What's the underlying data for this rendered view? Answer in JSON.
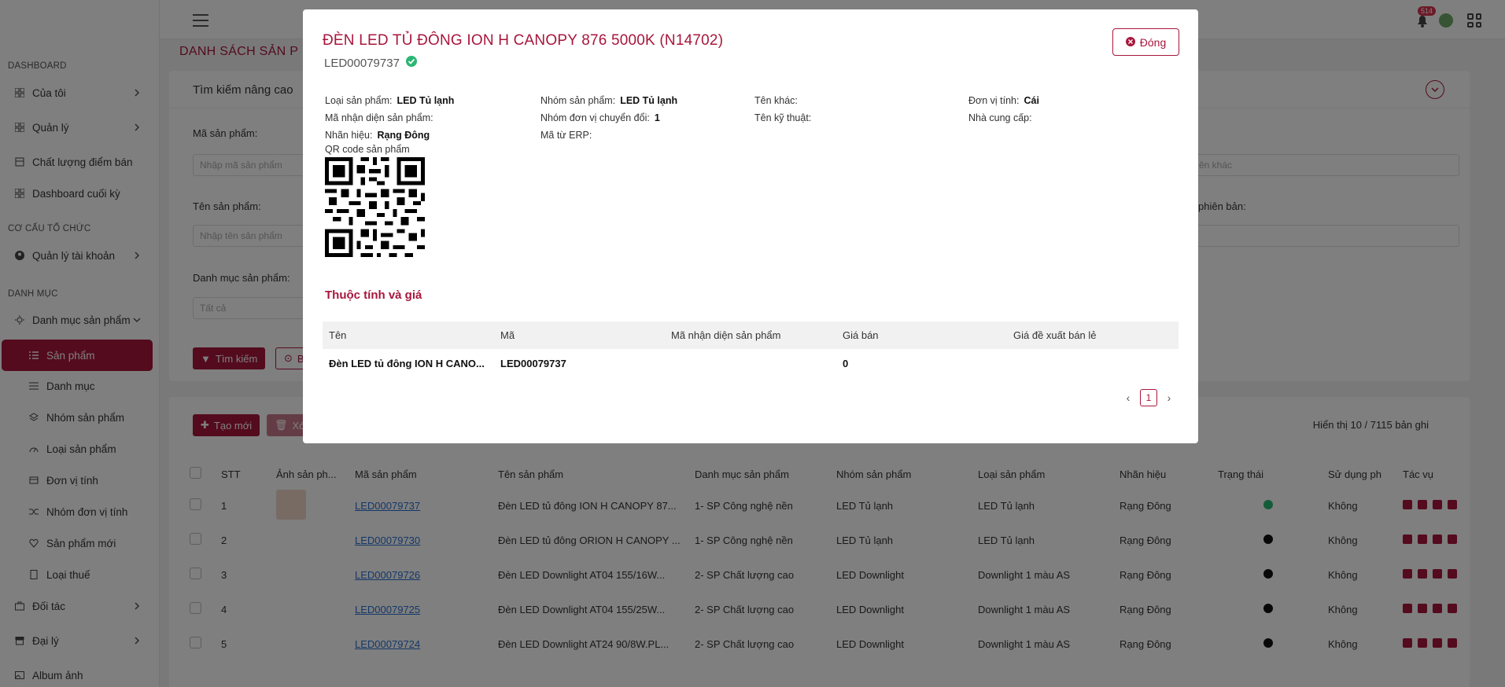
{
  "sidebar": {
    "sections": [
      "DASHBOARD",
      "CƠ CẤU TỔ CHỨC",
      "DANH MỤC"
    ],
    "items": [
      {
        "label": "Của tôi"
      },
      {
        "label": "Quản lý"
      },
      {
        "label": "Chất lượng điểm bán"
      },
      {
        "label": "Dashboard cuối kỳ"
      },
      {
        "label": "Quản lý tài khoản"
      },
      {
        "label": "Danh mục sản phẩm"
      },
      {
        "label": "Sản phẩm"
      },
      {
        "label": "Danh mục"
      },
      {
        "label": "Nhóm sản phẩm"
      },
      {
        "label": "Loại sản phẩm"
      },
      {
        "label": "Đơn vị tính"
      },
      {
        "label": "Nhóm đơn vị tính"
      },
      {
        "label": "Sản phẩm mới"
      },
      {
        "label": "Loại thuế"
      },
      {
        "label": "Đối tác"
      },
      {
        "label": "Đại lý"
      },
      {
        "label": "Album ảnh"
      }
    ]
  },
  "topbar": {
    "notification_count": "514"
  },
  "page": {
    "title": "DANH SÁCH SẢN P",
    "search": {
      "header": "Tìm kiếm nâng cao",
      "product_code_label": "Mã sản phẩm:",
      "product_code_placeholder": "Nhập mã sản phẩm",
      "product_name_label": "Tên sản phẩm:",
      "product_name_placeholder": "Nhập tên sản phẩm",
      "category_label": "Danh mục sản phẩm:",
      "category_placeholder": "Tất cả",
      "right_label_1": ":",
      "right_placeholder_1": "ên khác",
      "right_label_2": "phiên bản:",
      "search_button": "Tìm kiếm",
      "second_button": "B"
    },
    "list": {
      "create_button": "Tạo mới",
      "delete_button": "Xóa",
      "count_text": "Hiển thị 10 / 7115 bản ghi",
      "columns": [
        "STT",
        "Ảnh sản ph...",
        "Mã sản phẩm",
        "Tên sản phẩm",
        "Danh mục sản phẩm",
        "Nhóm sản phẩm",
        "Loại sản phẩm",
        "Nhãn hiệu",
        "Trạng thái",
        "Sử dụng ph",
        "Tác vụ"
      ],
      "rows": [
        {
          "stt": "1",
          "code": "LED00079737",
          "name": "Đèn LED tủ đông ION H CANOPY 87...",
          "category": "1- SP Công nghệ nền",
          "group": "LED Tủ lạnh",
          "type": "LED Tủ lạnh",
          "brand": "Rạng Đông",
          "usage": "Không"
        },
        {
          "stt": "2",
          "code": "LED00079730",
          "name": "Đèn LED tủ đông ORION H CANOPY ...",
          "category": "1- SP Công nghệ nền",
          "group": "LED Tủ lạnh",
          "type": "LED Tủ lạnh",
          "brand": "Rạng Đông",
          "usage": "Không"
        },
        {
          "stt": "3",
          "code": "LED00079726",
          "name": "Đèn LED Downlight AT04 155/16W...",
          "category": "2- SP Chất lượng cao",
          "group": "LED Downlight",
          "type": "Downlight 1 màu AS",
          "brand": "Rạng Đông",
          "usage": "Không"
        },
        {
          "stt": "4",
          "code": "LED00079725",
          "name": "Đèn LED Downlight AT04 155/25W...",
          "category": "2- SP Chất lượng cao",
          "group": "LED Downlight",
          "type": "Downlight 1 màu AS",
          "brand": "Rạng Đông",
          "usage": "Không"
        },
        {
          "stt": "5",
          "code": "LED00079724",
          "name": "Đèn LED Downlight AT24 90/8W.PL...",
          "category": "2- SP Chất lượng cao",
          "group": "LED Downlight",
          "type": "Downlight 1 màu AS",
          "brand": "Rạng Đông",
          "usage": "Không"
        }
      ]
    }
  },
  "modal": {
    "title": "ĐÈN LED TỦ ĐÔNG ION H CANOPY 876 5000K (N14702)",
    "code": "LED00079737",
    "close_label": "Đóng",
    "fields": {
      "product_type_label": "Loại sản phẩm:",
      "product_type_value": "LED Tủ lạnh",
      "product_group_label": "Nhóm sản phẩm:",
      "product_group_value": "LED Tủ lạnh",
      "other_name_label": "Tên khác:",
      "unit_label": "Đơn vị tính:",
      "unit_value": "Cái",
      "identifier_label": "Mã nhận diện sản phẩm:",
      "conversion_group_label": "Nhóm đơn vị chuyển đổi:",
      "conversion_group_value": "1",
      "technical_name_label": "Tên kỹ thuật:",
      "supplier_label": "Nhà cung cấp:",
      "brand_label": "Nhãn hiệu:",
      "brand_value": "Rạng Đông",
      "erp_code_label": "Mã từ ERP:"
    },
    "qr_label": "QR code sản phẩm",
    "section_title": "Thuộc tính và giá",
    "table": {
      "columns": [
        "Tên",
        "Mã",
        "Mã nhận diện sản phẩm",
        "Giá bán",
        "Giá đề xuất bán lẻ"
      ],
      "rows": [
        {
          "name": "Đèn LED tủ đông ION H CANO...",
          "code": "LED00079737",
          "identifier": "",
          "price": "0",
          "retail_price": ""
        }
      ]
    },
    "pager": {
      "current": "1"
    }
  },
  "colors": {
    "accent": "#a8163c",
    "success": "#2bb673",
    "link": "#2a6fd1"
  }
}
